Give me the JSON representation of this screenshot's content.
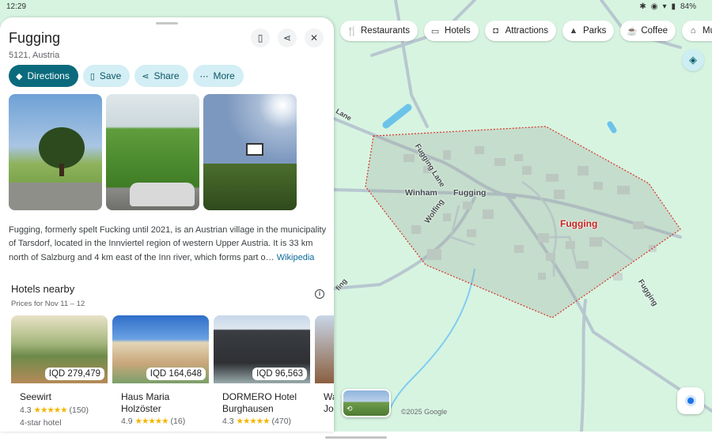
{
  "status_bar": {
    "time": "12:29",
    "battery": "84%"
  },
  "place": {
    "name": "Fugging",
    "address": "5121, Austria",
    "description": "Fugging, formerly spelt Fucking until 2021, is an Austrian village in the municipality of Tarsdorf, located in the Innviertel region of western Upper Austria. It is 33 km north of Salzburg and 4 km east of the Inn river, which forms part o…",
    "description_link": "Wikipedia"
  },
  "actions": [
    {
      "label": "Directions",
      "icon": "directions-icon"
    },
    {
      "label": "Save",
      "icon": "bookmark-icon"
    },
    {
      "label": "Share",
      "icon": "share-icon"
    },
    {
      "label": "More",
      "icon": "more-icon"
    }
  ],
  "hotels_section": {
    "title": "Hotels nearby",
    "subtitle": "Prices for Nov 11 – 12",
    "hotels": [
      {
        "name": "Seewirt",
        "price": "IQD 279,479",
        "rating": "4.3",
        "stars": "★★★★★",
        "reviews": "(150)",
        "type": "4-star hotel"
      },
      {
        "name": "Haus Maria Holzöster",
        "price": "IQD 164,648",
        "rating": "4.9",
        "stars": "★★★★★",
        "reviews": "(16)",
        "type": ""
      },
      {
        "name": "DORMERO Hotel Burghausen",
        "price": "IQD 96,563",
        "rating": "4.3",
        "stars": "★★★★★",
        "reviews": "(470)",
        "type": ""
      },
      {
        "name": "Wa Jo",
        "price": "",
        "rating": "",
        "stars": "",
        "reviews": "",
        "type": ""
      }
    ]
  },
  "map": {
    "chips": [
      {
        "label": "Restaurants",
        "icon": "fork-knife-icon"
      },
      {
        "label": "Hotels",
        "icon": "bed-icon"
      },
      {
        "label": "Attractions",
        "icon": "camera-icon"
      },
      {
        "label": "Parks",
        "icon": "tree-icon"
      },
      {
        "label": "Coffee",
        "icon": "coffee-icon"
      },
      {
        "label": "Museu",
        "icon": "museum-icon"
      }
    ],
    "labels": {
      "place": "Fugging",
      "road_fugging": "Fugging",
      "road_winham": "Winham",
      "road_fugging_lane": "Fugging Lane",
      "road_wolfing": "Wolfing",
      "road_fugging_se": "Fugging",
      "road_lane": "Lane",
      "road_fing": "fing"
    },
    "copyright": "©2025 Google",
    "colors": {
      "land": "#d7f4e1",
      "water": "#4fb6e3",
      "boundary": "#d93025",
      "accent": "#0b6b7c"
    }
  }
}
